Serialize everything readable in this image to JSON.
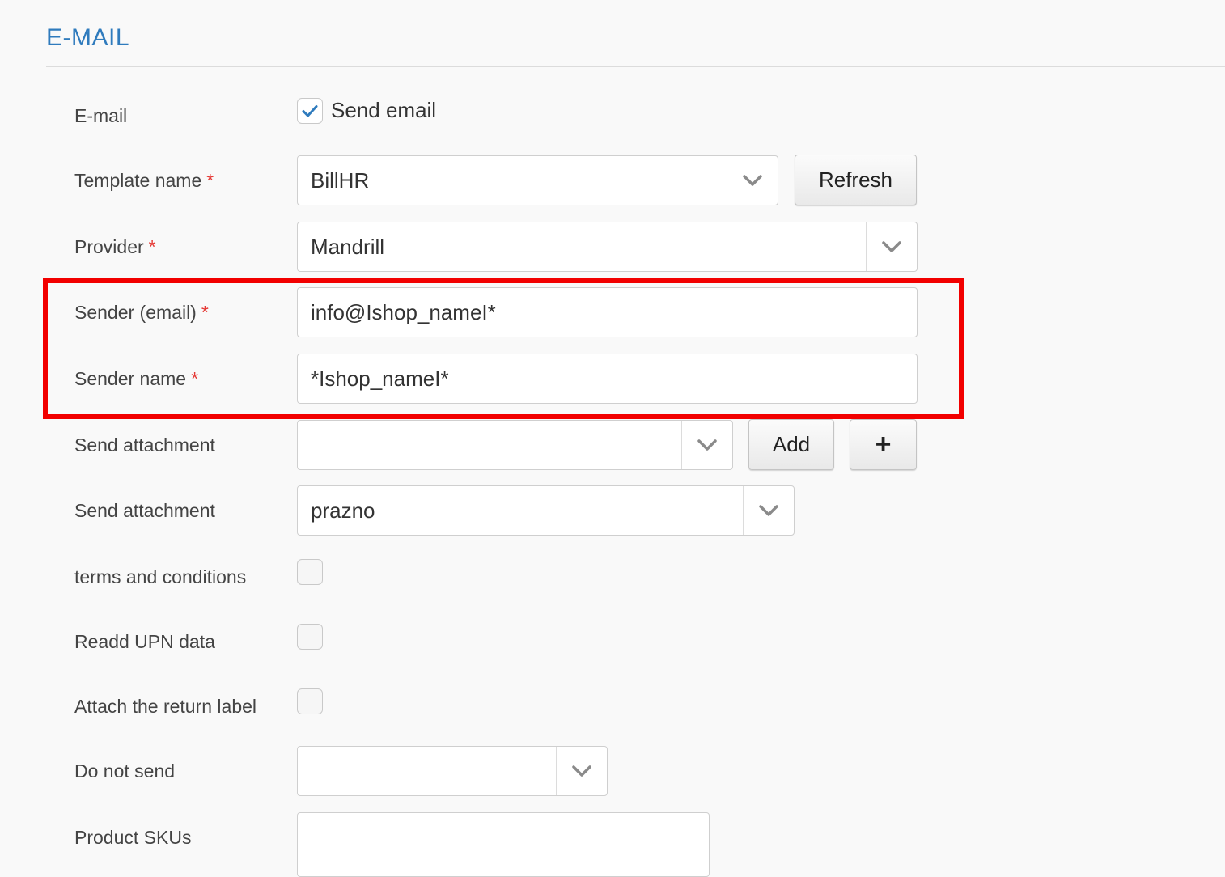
{
  "section": {
    "title": "E-MAIL"
  },
  "form": {
    "email": {
      "label": "E-mail",
      "checkbox_label": "Send email",
      "checked": true
    },
    "template_name": {
      "label": "Template name",
      "required": "*",
      "value": "BillHR",
      "refresh_label": "Refresh"
    },
    "provider": {
      "label": "Provider",
      "required": "*",
      "value": "Mandrill"
    },
    "sender_email": {
      "label": "Sender (email)",
      "required": "*",
      "value": "info@Ishop_nameI*"
    },
    "sender_name": {
      "label": "Sender name",
      "required": "*",
      "value": "*Ishop_nameI*"
    },
    "send_attachment_1": {
      "label": "Send attachment",
      "value": "",
      "add_label": "Add",
      "plus_label": "+"
    },
    "send_attachment_2": {
      "label": "Send attachment",
      "value": "prazno"
    },
    "terms": {
      "label": "terms and conditions",
      "checked": false
    },
    "readd_upn": {
      "label": "Readd UPN data",
      "checked": false
    },
    "return_label": {
      "label": "Attach the return label",
      "checked": false
    },
    "do_not_send": {
      "label": "Do not send",
      "value": ""
    },
    "product_skus": {
      "label": "Product SKUs",
      "value": ""
    }
  },
  "colors": {
    "accent": "#2f7bbd",
    "required": "#e53935",
    "highlight": "#f20000",
    "check": "#2f7bbd"
  },
  "icons": {
    "select": "chevron-down-icon",
    "check": "checkmark-icon"
  }
}
